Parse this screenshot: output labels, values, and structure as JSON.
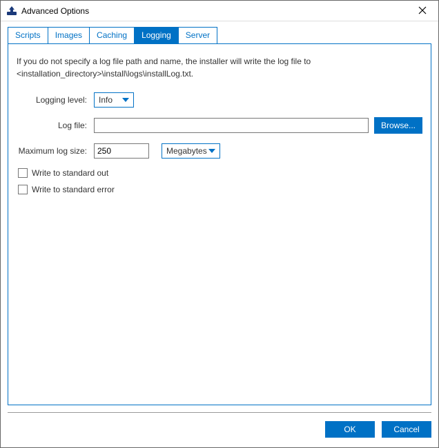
{
  "window": {
    "title": "Advanced Options"
  },
  "tabs": {
    "scripts": "Scripts",
    "images": "Images",
    "caching": "Caching",
    "logging": "Logging",
    "server": "Server"
  },
  "logging": {
    "description": "If you do not specify a log file path and name, the installer will write the log file to <installation_directory>\\install\\logs\\installLog.txt.",
    "level_label": "Logging level:",
    "level_value": "Info",
    "file_label": "Log file:",
    "file_value": "",
    "browse_label": "Browse...",
    "maxsize_label": "Maximum log size:",
    "maxsize_value": "250",
    "maxsize_unit": "Megabytes",
    "stdout_label": "Write to standard out",
    "stderr_label": "Write to standard error"
  },
  "footer": {
    "ok": "OK",
    "cancel": "Cancel"
  }
}
